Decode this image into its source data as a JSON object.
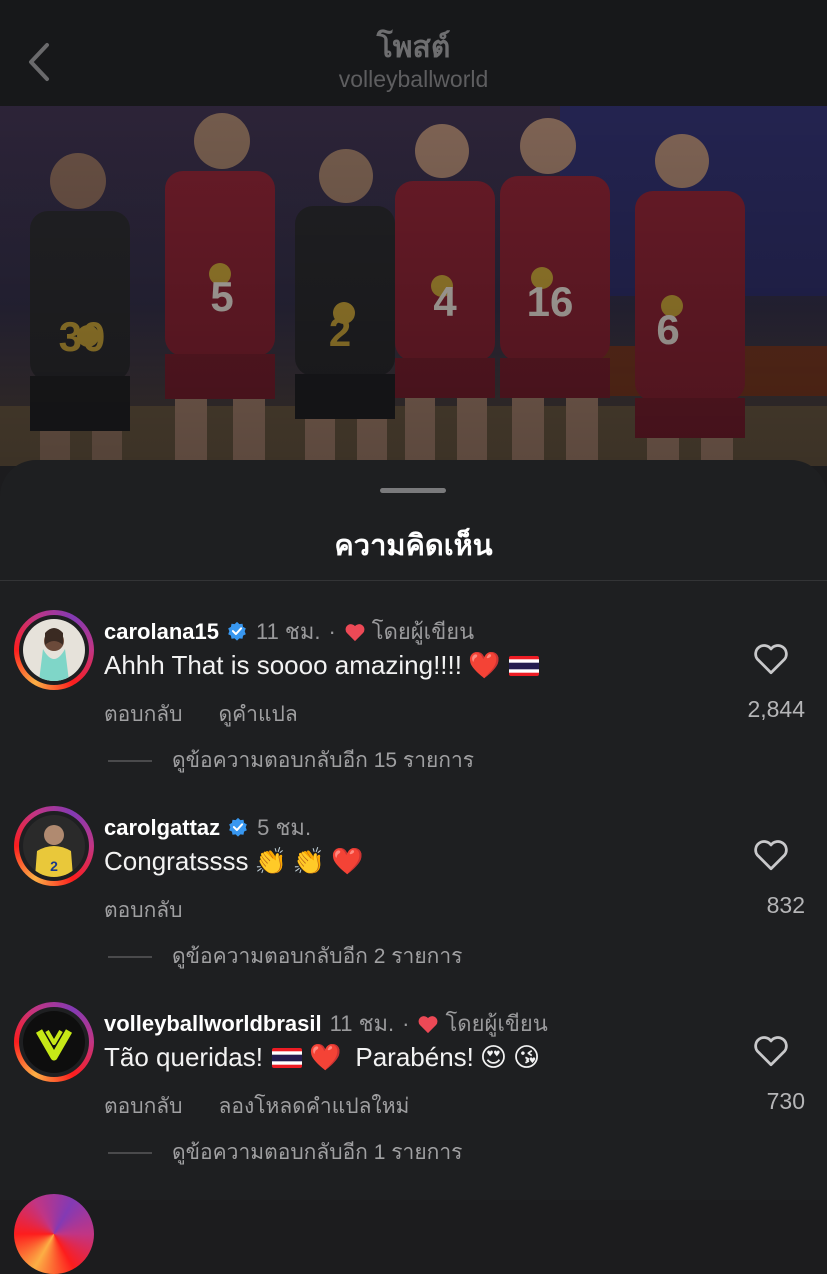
{
  "header": {
    "title": "โพสต์",
    "subtitle": "volleyballworld",
    "back_icon": "chevron-left-icon"
  },
  "photo": {
    "jersey_numbers": [
      "30",
      "5",
      "2",
      "4",
      "16",
      "6"
    ]
  },
  "comments_sheet": {
    "title": "ความคิดเห็น"
  },
  "comments": [
    {
      "username": "carolana15",
      "verified": true,
      "time": "11 ชม.",
      "liked_by_author": true,
      "author_label": "โดยผู้เขียน",
      "text": "Ahhh That is soooo amazing!!!!",
      "emoji": [
        "❤️",
        "🇹🇭"
      ],
      "actions": [
        "ตอบกลับ",
        "ดูคำแปล"
      ],
      "likes": "2,844",
      "replies_label": "ดูข้อความตอบกลับอีก 15 รายการ"
    },
    {
      "username": "carolgattaz",
      "verified": true,
      "time": "5 ชม.",
      "liked_by_author": false,
      "author_label": "",
      "text": "Congratssss",
      "emoji": [
        "👏",
        "👏",
        "❤️"
      ],
      "actions": [
        "ตอบกลับ"
      ],
      "likes": "832",
      "replies_label": "ดูข้อความตอบกลับอีก 2 รายการ"
    },
    {
      "username": "volleyballworldbrasil",
      "verified": false,
      "time": "11 ชม.",
      "liked_by_author": true,
      "author_label": "โดยผู้เขียน",
      "text": "Tão queridas!",
      "emoji": [
        "🇹🇭",
        "❤️"
      ],
      "text2": "Parabéns!",
      "emoji2": [
        "😍",
        "😘"
      ],
      "actions": [
        "ตอบกลับ",
        "ลองโหลดคำแปลใหม่"
      ],
      "likes": "730",
      "replies_label": "ดูข้อความตอบกลับอีก 1 รายการ"
    }
  ],
  "colors": {
    "verified_blue": "#3897f0",
    "heart_red": "#ed4956",
    "background": "#1e1f21"
  }
}
